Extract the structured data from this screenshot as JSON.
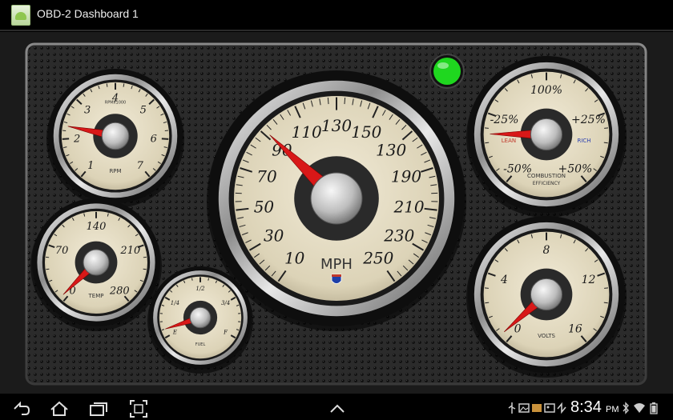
{
  "window": {
    "title": "OBD-2 Dashboard 1",
    "icon": "android-app-icon"
  },
  "indicator": {
    "state": "connected",
    "color": "#1fd71f"
  },
  "gauges": {
    "rpm": {
      "unit": "RPM",
      "sub": "RPMx1000",
      "ticks": [
        "1",
        "2",
        "3",
        "4",
        "5",
        "6",
        "7"
      ],
      "value": 1.5
    },
    "speed": {
      "unit": "MPH",
      "ticks": [
        "10",
        "30",
        "50",
        "70",
        "90",
        "110",
        "130",
        "150",
        "130",
        "190",
        "210",
        "230",
        "250"
      ],
      "value": 72
    },
    "efficiency": {
      "unit": "COMBUSTION",
      "unit2": "EFFICIENCY",
      "ticks": [
        "-50%",
        "-25%",
        "100%",
        "+25%",
        "+50%"
      ],
      "lean": "LEAN",
      "rich": "RICH",
      "value": "-25%"
    },
    "temp": {
      "unit": "TEMP",
      "ticks": [
        "0",
        "70",
        "140",
        "210",
        "280"
      ],
      "value": 0
    },
    "fuel": {
      "unit": "FUEL",
      "ticks": [
        "E",
        "1/4",
        "1/2",
        "3/4",
        "F"
      ],
      "value": "E"
    },
    "volts": {
      "unit": "VOLTS",
      "ticks": [
        "0",
        "4",
        "8",
        "12",
        "16"
      ],
      "value": 0
    }
  },
  "navbar": {
    "back": "back-icon",
    "home": "home-icon",
    "recent": "recent-apps-icon",
    "screenshot": "screenshot-icon",
    "menu": "menu-up-icon"
  },
  "status": {
    "time": "8:34",
    "ampm": "PM"
  }
}
